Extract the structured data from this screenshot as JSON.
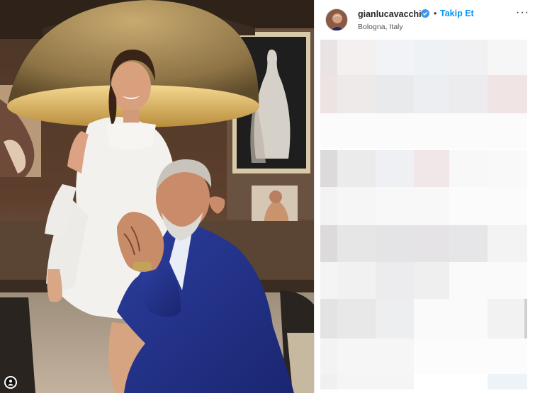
{
  "post": {
    "username": "gianlucavacchi",
    "follow_label": "Takip Et",
    "location": "Bologna, Italy",
    "separator": "•",
    "more_label": "···"
  },
  "icons": {
    "verified": "verified-badge-icon",
    "more": "more-options-icon",
    "corner": "instagram-tag-icon"
  },
  "colors": {
    "follow_blue": "#0095f6",
    "verified_blue": "#3897f0",
    "username": "#262626"
  }
}
